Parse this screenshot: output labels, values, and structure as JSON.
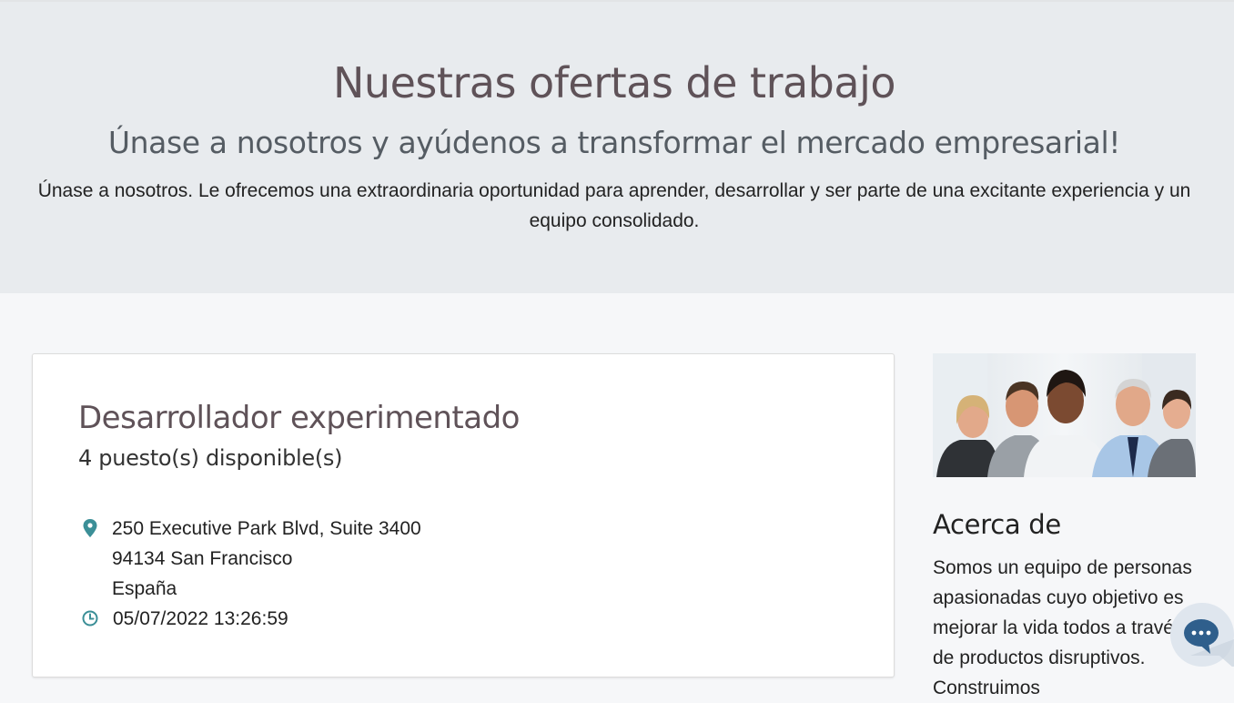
{
  "hero": {
    "title": "Nuestras ofertas de trabajo",
    "subtitle": "Únase a nosotros y ayúdenos a transformar el mercado empresarial!",
    "text": "Únase a nosotros. Le ofrecemos una extraordinaria oportunidad para aprender, desarrollar y ser parte de una excitante experiencia y un equipo consolidado."
  },
  "job": {
    "title": "Desarrollador experimentado",
    "positions": "4 puesto(s) disponible(s)",
    "address_line1": "250 Executive Park Blvd, Suite 3400",
    "address_line2": "94134 San Francisco",
    "address_line3": "España",
    "date": "05/07/2022 13:26:59"
  },
  "about": {
    "title": "Acerca de",
    "text": "Somos un equipo de personas apasionadas cuyo objetivo es mejorar la vida todos a través de productos disruptivos. Construimos"
  },
  "colors": {
    "hero_bg": "#e8ebee",
    "accent_icon": "#3b8f97",
    "title_color": "#5f5258"
  },
  "icons": {
    "location": "map-marker-icon",
    "clock": "clock-icon",
    "chat": "chat-bubble-icon"
  }
}
